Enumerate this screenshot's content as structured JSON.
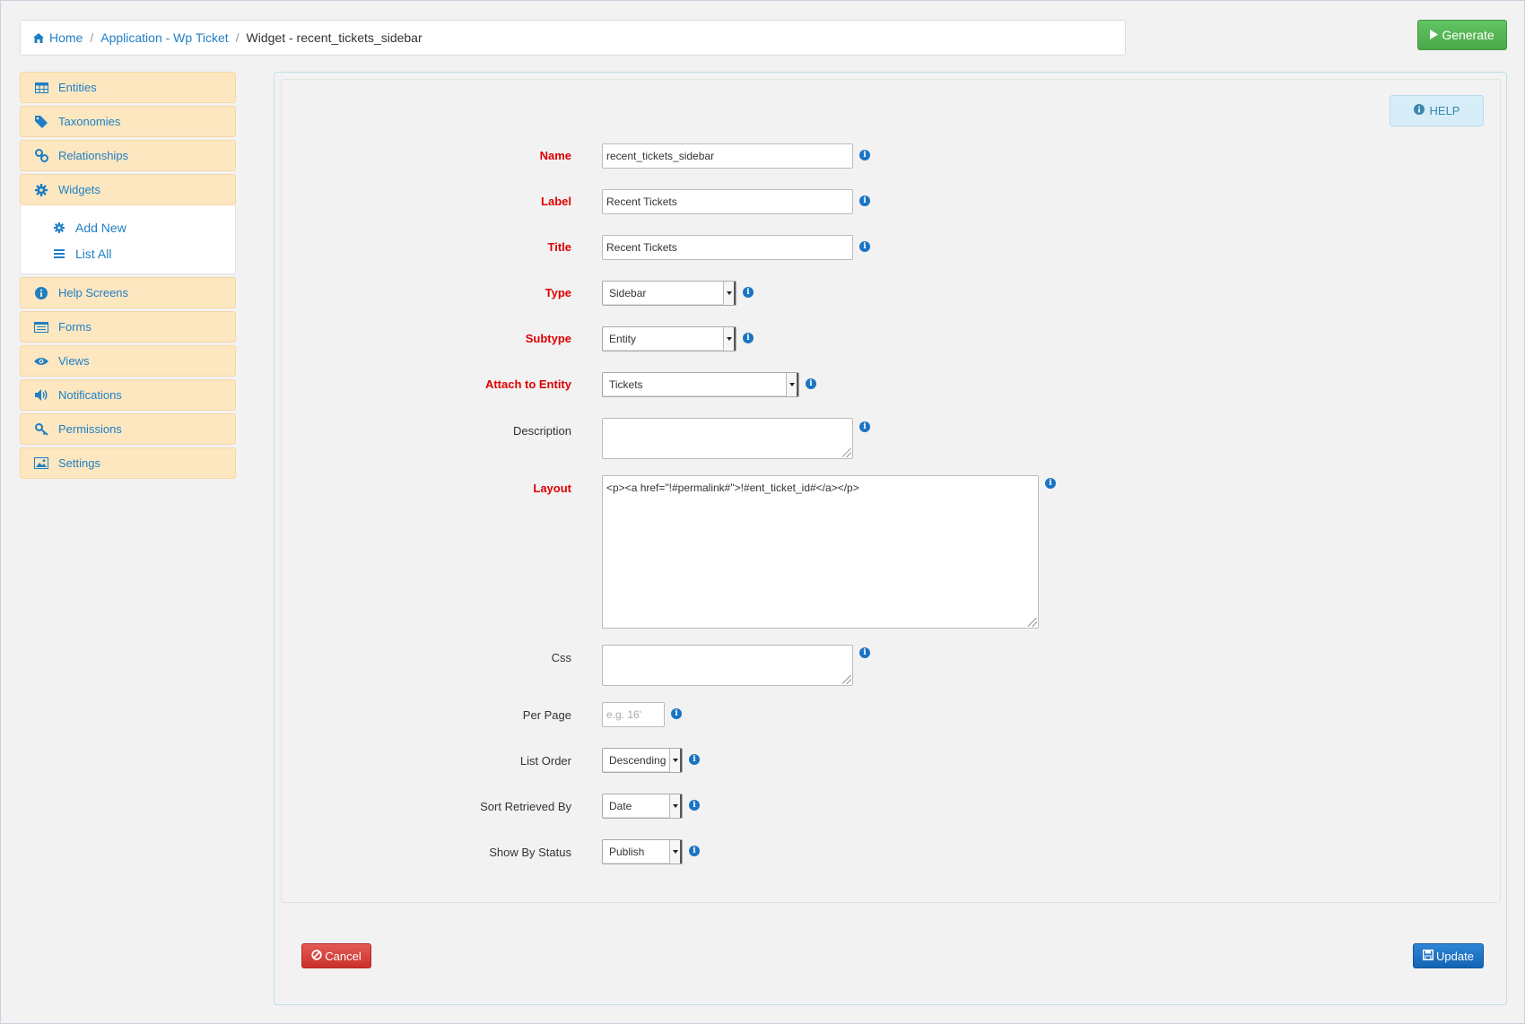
{
  "breadcrumb": {
    "home": "Home",
    "application": "Application - Wp Ticket",
    "current": "Widget - recent_tickets_sidebar"
  },
  "generate_label": "Generate",
  "help_label": "HELP",
  "sidebar": {
    "items": [
      {
        "label": "Entities",
        "icon": "table-icon"
      },
      {
        "label": "Taxonomies",
        "icon": "tag-icon"
      },
      {
        "label": "Relationships",
        "icon": "link-icon"
      },
      {
        "label": "Widgets",
        "icon": "gear-icon"
      },
      {
        "label": "Help Screens",
        "icon": "info-icon"
      },
      {
        "label": "Forms",
        "icon": "form-icon"
      },
      {
        "label": "Views",
        "icon": "eye-icon"
      },
      {
        "label": "Notifications",
        "icon": "volume-icon"
      },
      {
        "label": "Permissions",
        "icon": "key-icon"
      },
      {
        "label": "Settings",
        "icon": "image-icon"
      }
    ],
    "widgets_sub": {
      "add_new": "Add New",
      "list_all": "List All"
    }
  },
  "form": {
    "name": {
      "label": "Name",
      "value": "recent_tickets_sidebar"
    },
    "label": {
      "label": "Label",
      "value": "Recent Tickets"
    },
    "title": {
      "label": "Title",
      "value": "Recent Tickets"
    },
    "type": {
      "label": "Type",
      "value": "Sidebar"
    },
    "subtype": {
      "label": "Subtype",
      "value": "Entity"
    },
    "attach": {
      "label": "Attach to Entity",
      "value": "Tickets"
    },
    "description": {
      "label": "Description",
      "value": ""
    },
    "layout": {
      "label": "Layout",
      "value": "<p><a href=\"!#permalink#\">!#ent_ticket_id#</a></p>"
    },
    "css": {
      "label": "Css",
      "value": ""
    },
    "per_page": {
      "label": "Per Page",
      "value": "",
      "placeholder": "e.g. 16'"
    },
    "list_order": {
      "label": "List Order",
      "value": "Descending"
    },
    "sort_by": {
      "label": "Sort Retrieved By",
      "value": "Date"
    },
    "status": {
      "label": "Show By Status",
      "value": "Publish"
    }
  },
  "buttons": {
    "cancel": "Cancel",
    "update": "Update"
  },
  "colors": {
    "link": "#1f7fc4",
    "required": "#dd0000",
    "sidebar_bg": "#fde7c1",
    "generate": "#4aa84a",
    "cancel": "#c9302c",
    "update": "#1463b5"
  }
}
